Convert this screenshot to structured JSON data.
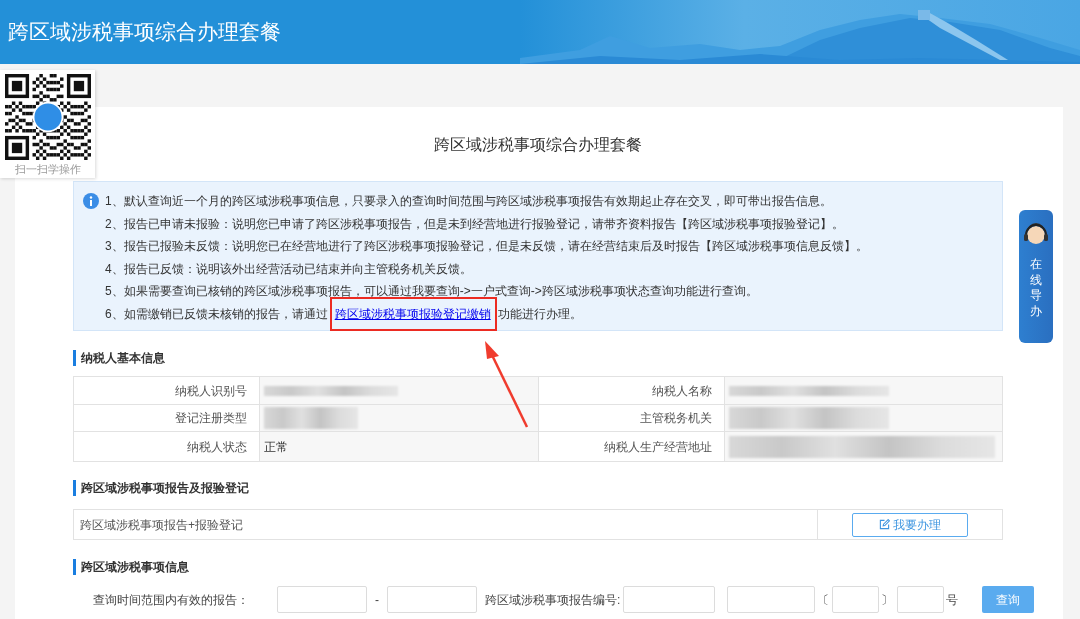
{
  "header": {
    "title": "跨区域涉税事项综合办理套餐"
  },
  "qr_card": {
    "caption": "扫一扫学操作"
  },
  "page_title": "跨区域涉税事项综合办理套餐",
  "notice": {
    "lines": [
      {
        "text": "1、默认查询近一个月的跨区域涉税事项信息，只要录入的查询时间范围与跨区域涉税事项报告有效期起止存在交叉，即可带出报告信息。"
      },
      {
        "text": "2、报告已申请未报验：说明您已申请了跨区涉税事项报告，但是未到经营地进行报验登记，请带齐资料报告【跨区域涉税事项报验登记】。"
      },
      {
        "text": "3、报告已报验未反馈：说明您已在经营地进行了跨区涉税事项报验登记，但是未反馈，请在经营结束后及时报告【跨区域涉税事项信息反馈】。"
      },
      {
        "text": "4、报告已反馈：说明该外出经营活动已结束并向主管税务机关反馈。"
      },
      {
        "text": "5、如果需要查询已核销的跨区域涉税事项报告，可以通过我要查询->一户式查询->跨区域涉税事项状态查询功能进行查询。"
      },
      {
        "text": "6、如需缴销已反馈未核销的报告，请通过",
        "link": "跨区域涉税事项报验登记缴销",
        "after": "功能进行办理。",
        "highlighted": true
      }
    ]
  },
  "taxpayer_info": {
    "heading": "纳税人基本信息",
    "rows": [
      [
        {
          "label": "纳税人识别号",
          "redacted": true
        },
        {
          "label": "纳税人名称",
          "redacted": true
        }
      ],
      [
        {
          "label": "登记注册类型",
          "redacted": true
        },
        {
          "label": "主管税务机关",
          "redacted": true
        }
      ],
      [
        {
          "label": "纳税人状态",
          "value": "正常",
          "redacted": false
        },
        {
          "label": "纳税人生产经营地址",
          "redacted": true
        }
      ]
    ]
  },
  "report_section": {
    "heading": "跨区域涉税事项报告及报验登记",
    "item": "跨区域涉税事项报告+报验登记",
    "button": "我要办理"
  },
  "query_section": {
    "heading": "跨区域涉税事项信息",
    "fields": [
      {
        "kind": "label",
        "text": "查询时间范围内有效的报告："
      },
      {
        "kind": "input"
      },
      {
        "kind": "sep",
        "text": "-"
      },
      {
        "kind": "input"
      },
      {
        "kind": "label",
        "text": "跨区域涉税事项报告编号:"
      },
      {
        "kind": "input"
      },
      {
        "kind": "input"
      },
      {
        "kind": "sep",
        "text": "〔"
      },
      {
        "kind": "input"
      },
      {
        "kind": "sep",
        "text": "〕"
      },
      {
        "kind": "input"
      },
      {
        "kind": "sep",
        "text": "号"
      },
      {
        "kind": "button",
        "text": "查询"
      }
    ]
  },
  "side_tab": {
    "label": "在线导办"
  }
}
